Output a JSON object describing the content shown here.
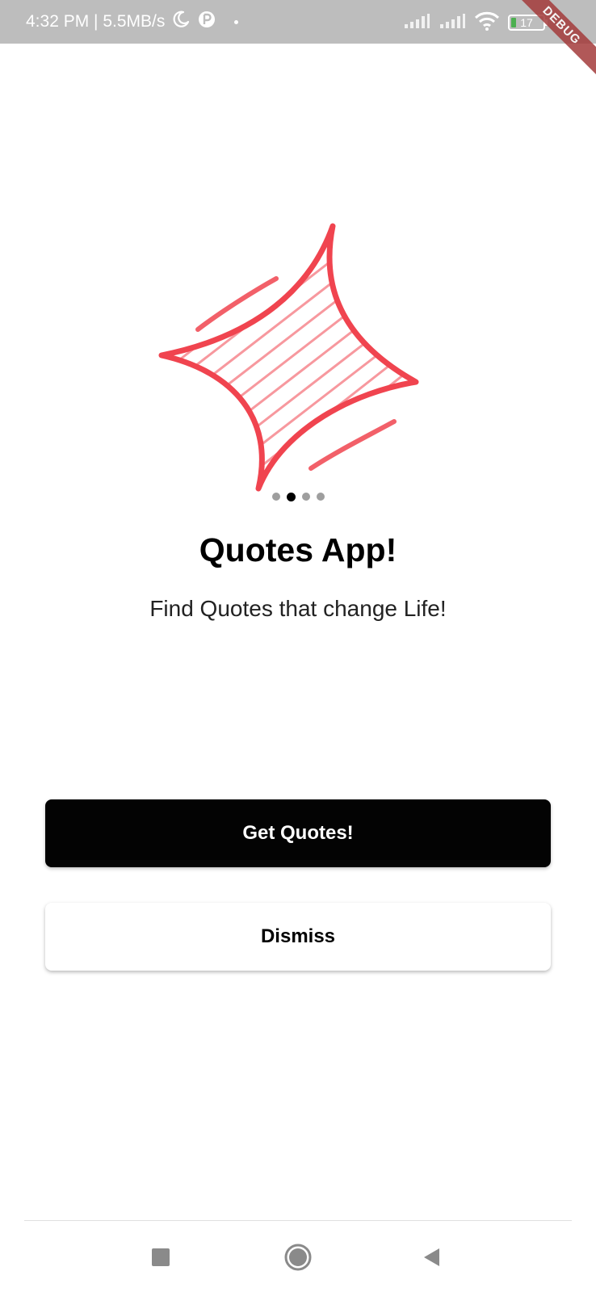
{
  "status_bar": {
    "time_speed": "4:32 PM | 5.5MB/s",
    "moon_icon": "moon-icon",
    "app_icon": "circle-p-icon",
    "battery_level": "17",
    "battery_percent": 17,
    "debug_label": "DEBUG"
  },
  "illustration": {
    "icon": "sparkle-star-icon",
    "color": "#f0444f"
  },
  "page_indicator": {
    "count": 4,
    "active_index": 1
  },
  "main": {
    "title": "Quotes App!",
    "subtitle": "Find Quotes that change Life!"
  },
  "buttons": {
    "primary_label": "Get Quotes!",
    "secondary_label": "Dismiss"
  },
  "nav": {
    "recent_icon": "square-recent-apps-icon",
    "home_icon": "circle-home-icon",
    "back_icon": "triangle-back-icon"
  },
  "colors": {
    "status_bar_bg": "#bdbdbd",
    "primary_button_bg": "#030303",
    "accent_red": "#f0444f",
    "debug_banner": "#a43b3b"
  }
}
